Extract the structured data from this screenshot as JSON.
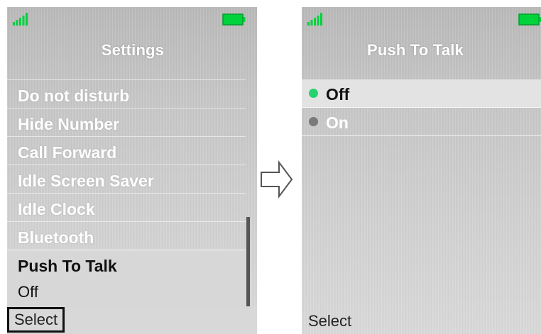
{
  "colors": {
    "signal": "#00d23c",
    "battery": "#00d23c",
    "radio_selected": "#24d36d",
    "radio_unselected": "#7a7a7a",
    "selected_row": "#d7d7d7",
    "softkey_border": "#111111"
  },
  "left_screen": {
    "title": "Settings",
    "icons": {
      "signal": "signal-strength-icon",
      "battery": "battery-icon"
    },
    "menu": {
      "items": [
        {
          "label": "Do not disturb"
        },
        {
          "label": "Hide Number"
        },
        {
          "label": "Call Forward"
        },
        {
          "label": "Idle Screen Saver"
        },
        {
          "label": "Idle Clock"
        },
        {
          "label": "Bluetooth"
        },
        {
          "label": "Push To Talk",
          "value": "Off",
          "selected": true
        }
      ]
    },
    "softkey": {
      "left": "Select"
    }
  },
  "transition": {
    "icon": "right-arrow-icon"
  },
  "right_screen": {
    "title": "Push To Talk",
    "icons": {
      "signal": "signal-strength-icon",
      "battery": "battery-icon"
    },
    "options": [
      {
        "label": "Off",
        "selected": true
      },
      {
        "label": "On",
        "selected": false
      }
    ],
    "softkey": {
      "left": "Select"
    }
  }
}
